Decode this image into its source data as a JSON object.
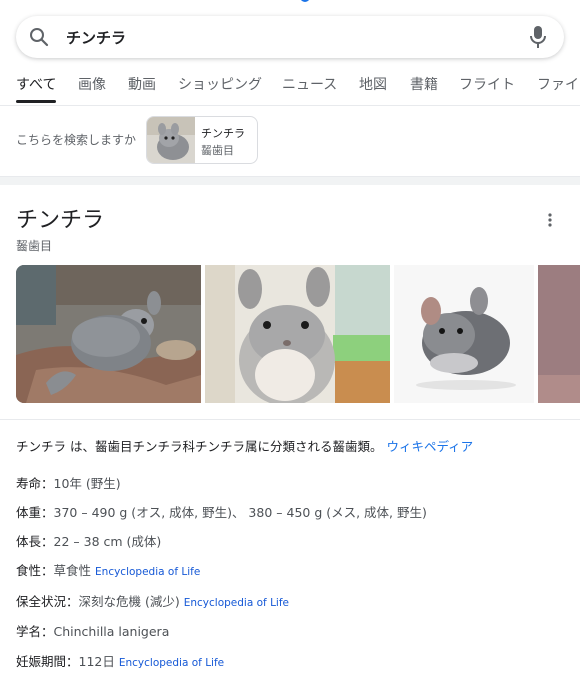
{
  "search": {
    "query": "チンチラ"
  },
  "tabs": [
    "すべて",
    "画像",
    "動画",
    "ショッピング",
    "ニュース",
    "地図",
    "書籍",
    "フライト",
    "ファイ"
  ],
  "suggestion": {
    "label": "こちらを検索しますか",
    "chip_title": "チンチラ",
    "chip_subtitle": "齧歯目"
  },
  "panel": {
    "title": "チンチラ",
    "subtitle": "齧歯目",
    "description": "チンチラ は、齧歯目チンチラ科チンチラ属に分類される齧歯類。",
    "description_link": "ウィキペディア"
  },
  "facts": [
    {
      "label": "寿命：",
      "value": "10年 (野生)",
      "source": ""
    },
    {
      "label": "体重：",
      "value": "370 – 490 g (オス, 成体, 野生)、 380 – 450 g (メス, 成体, 野生)",
      "source": ""
    },
    {
      "label": "体長：",
      "value": "22 – 38 cm (成体)",
      "source": ""
    },
    {
      "label": "食性：",
      "value": "草食性",
      "source": "Encyclopedia of Life"
    },
    {
      "label": "保全状況：",
      "value": "深刻な危機 (減少)",
      "source": "Encyclopedia of Life"
    },
    {
      "label": "学名：",
      "value": "Chinchilla lanigera",
      "source": ""
    },
    {
      "label": "妊娠期間：",
      "value": "112日",
      "source": "Encyclopedia of Life"
    }
  ],
  "icons": {
    "search": "search-icon",
    "mic": "mic-icon",
    "more": "more-vert-icon"
  },
  "colors": {
    "link": "#1a73e8",
    "source_link": "#1558d6",
    "active_tab": "#202124"
  }
}
